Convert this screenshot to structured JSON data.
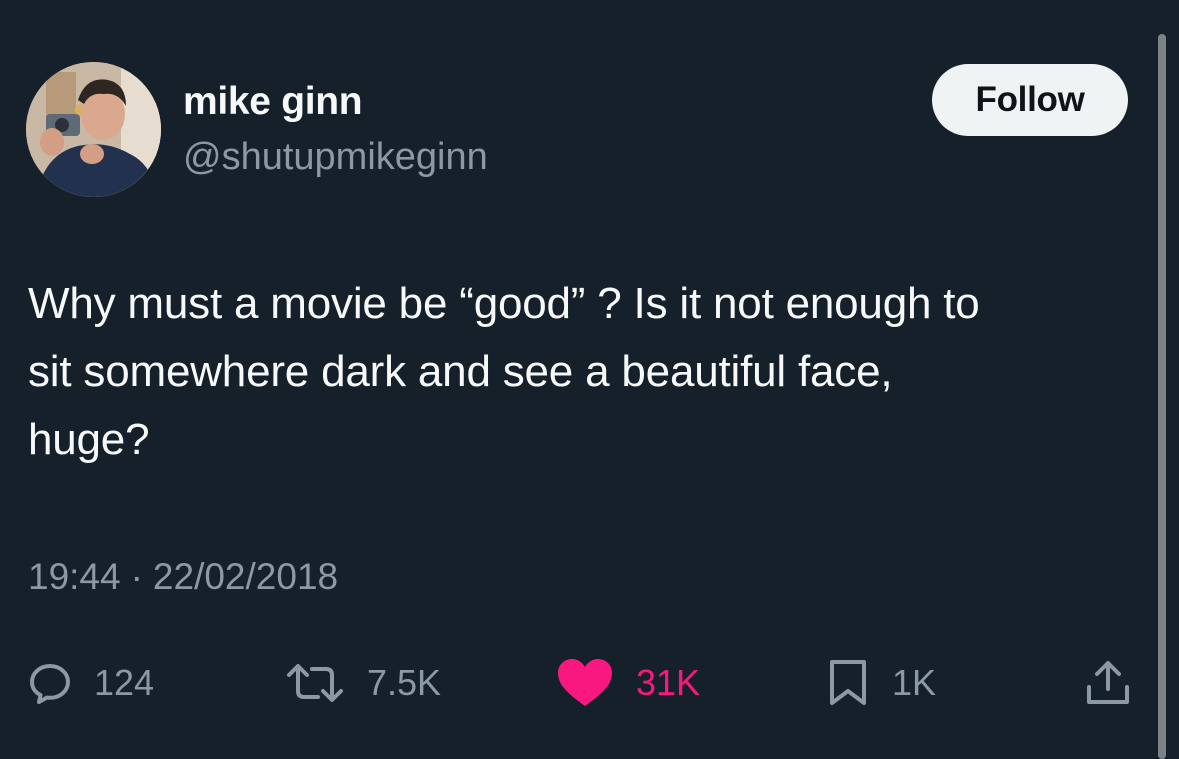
{
  "author": {
    "display_name": "mike ginn",
    "handle": "@shutupmikeginn"
  },
  "follow_button": {
    "label": "Follow"
  },
  "tweet": {
    "lines": [
      "Why must a movie be “good” ? Is it not enough to",
      "sit somewhere dark and see a beautiful face,",
      "huge?"
    ],
    "time": "19:44",
    "separator": "·",
    "date": "22/02/2018"
  },
  "actions": {
    "replies": {
      "icon": "reply-icon",
      "count": "124"
    },
    "retweets": {
      "icon": "retweet-icon",
      "count": "7.5K"
    },
    "likes": {
      "icon": "heart-icon",
      "count": "31K",
      "liked": true
    },
    "bookmarks": {
      "icon": "bookmark-icon",
      "count": "1K"
    },
    "share": {
      "icon": "share-icon"
    }
  },
  "colors": {
    "background": "#15202b",
    "primary_text": "#f7f9f9",
    "secondary_text": "#8b98a5",
    "like_active": "#f91880",
    "follow_button_bg": "#eff3f4"
  }
}
